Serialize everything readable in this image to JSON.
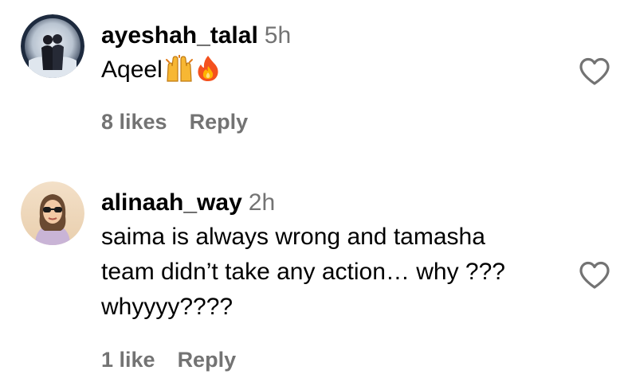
{
  "comments": [
    {
      "username": "ayeshah_talal",
      "time": "5h",
      "text": "Aqeel",
      "emojis": [
        "raising-hands-emoji",
        "fire-emoji"
      ],
      "likes": "8 likes",
      "reply": "Reply",
      "avatar_icon": "avatar-couple-photo",
      "like_icon": "heart-outline-icon"
    },
    {
      "username": "alinaah_way",
      "time": "2h",
      "text_lines": [
        "saima is always wrong and tamasha",
        "team didn’t take any action… why ???",
        "whyyyy????"
      ],
      "likes": "1 like",
      "reply": "Reply",
      "avatar_icon": "avatar-woman-sunglasses-photo",
      "like_icon": "heart-outline-icon"
    }
  ],
  "colors": {
    "text": "#000000",
    "secondary": "#737373",
    "background": "#ffffff"
  }
}
